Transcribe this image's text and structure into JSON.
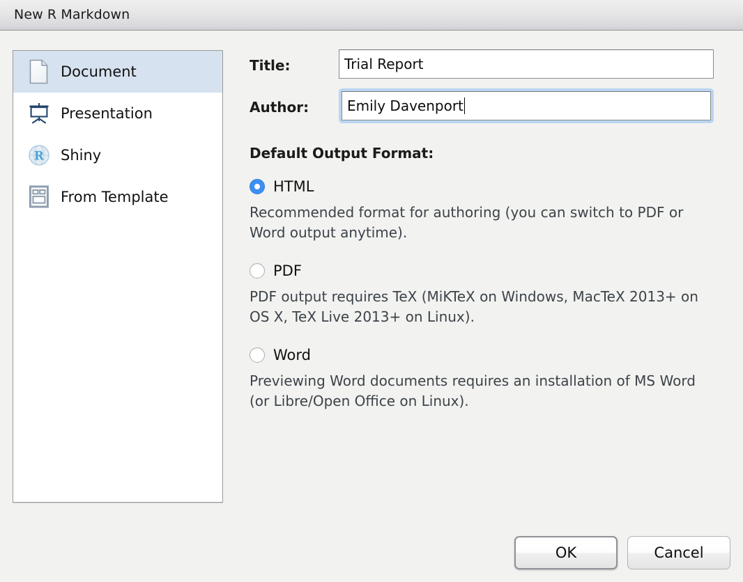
{
  "window": {
    "title": "New R Markdown"
  },
  "sidebar": {
    "items": [
      {
        "label": "Document",
        "icon": "document-icon",
        "selected": true
      },
      {
        "label": "Presentation",
        "icon": "presentation-icon",
        "selected": false
      },
      {
        "label": "Shiny",
        "icon": "shiny-r-globe-icon",
        "selected": false
      },
      {
        "label": "From Template",
        "icon": "template-icon",
        "selected": false
      }
    ]
  },
  "form": {
    "title_label": "Title:",
    "title_value": "Trial Report",
    "title_placeholder": "",
    "author_label": "Author:",
    "author_value": "Emily Davenport",
    "author_placeholder": "",
    "author_focused": true
  },
  "output_format": {
    "heading": "Default Output Format:",
    "selected": "HTML",
    "options": [
      {
        "label": "HTML",
        "checked": true,
        "description": "Recommended format for authoring (you can switch to PDF or Word output anytime)."
      },
      {
        "label": "PDF",
        "checked": false,
        "description": "PDF output requires TeX (MiKTeX on Windows, MacTeX 2013+ on OS X, TeX Live 2013+ on Linux)."
      },
      {
        "label": "Word",
        "checked": false,
        "description": "Previewing Word documents requires an installation of MS Word (or Libre/Open Office on Linux)."
      }
    ]
  },
  "footer": {
    "ok_label": "OK",
    "cancel_label": "Cancel"
  },
  "colors": {
    "accent_blue": "#3d8ff2",
    "selection_blue": "#d6e2ef",
    "focus_ring_blue": "#b9d6f2",
    "window_background": "#f2f2f0",
    "titlebar_top": "#efefef",
    "titlebar_bottom": "#cdcdd1"
  }
}
